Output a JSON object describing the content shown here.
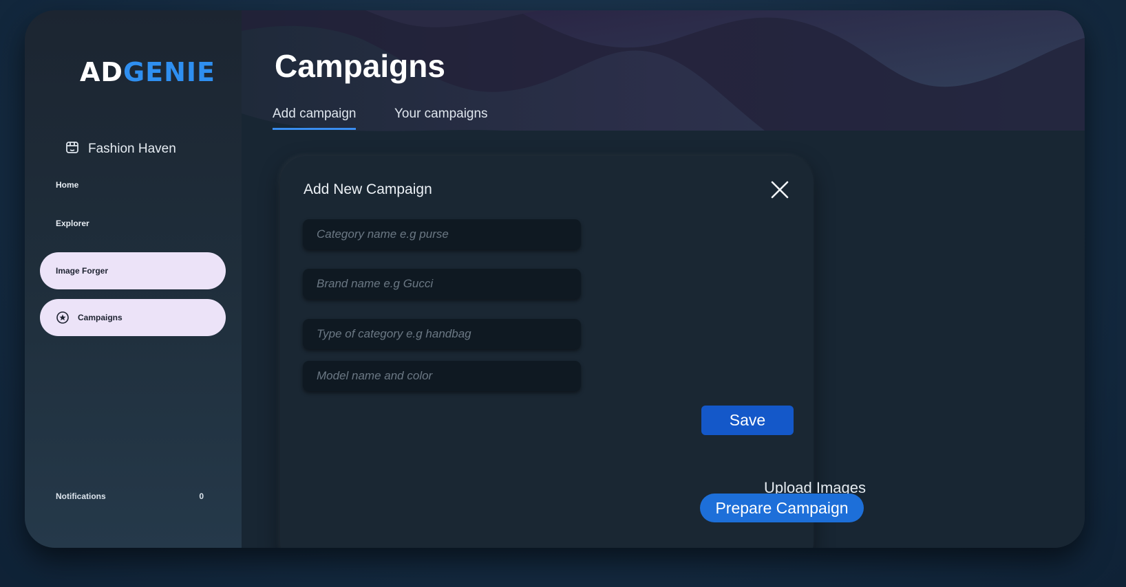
{
  "brand": {
    "logo_main": "AD",
    "logo_accent": "GENIE",
    "store_name": "Fashion Haven"
  },
  "sidebar": {
    "items": [
      {
        "label": "Home"
      },
      {
        "label": "Explorer"
      },
      {
        "label": "Image Forger"
      },
      {
        "label": "Campaigns"
      }
    ],
    "notifications": {
      "label": "Notifications",
      "count": "0"
    }
  },
  "header": {
    "title": "Campaigns",
    "tabs": [
      {
        "label": "Add campaign"
      },
      {
        "label": "Your campaigns"
      }
    ]
  },
  "modal": {
    "title": "Add New Campaign",
    "fields": [
      {
        "placeholder": "Category name e.g purse"
      },
      {
        "placeholder": "Brand name e.g Gucci"
      },
      {
        "placeholder": "Type of category e.g handbag"
      },
      {
        "placeholder": "Model name and color"
      }
    ],
    "save_label": "Save"
  },
  "footer": {
    "upload_label": "Upload Images",
    "prepare_label": "Prepare Campaign"
  },
  "colors": {
    "accent": "#1d6fd9",
    "save": "#1458c9",
    "pill": "#ece3f8",
    "logo_accent": "#2f8ff0"
  },
  "icons": {
    "store": "store-icon",
    "campaigns": "star-circle-icon",
    "close": "close-icon"
  }
}
